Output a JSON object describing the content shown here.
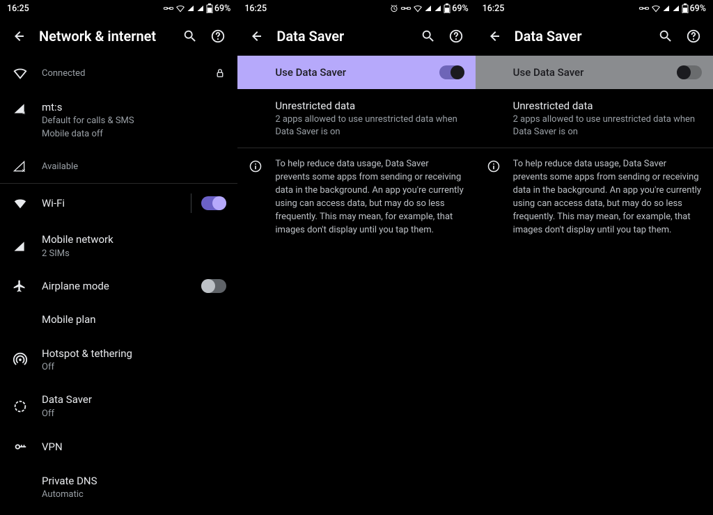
{
  "status": {
    "time": "16:25",
    "battery": "69%"
  },
  "pane1": {
    "title": "Network & internet",
    "wifi_status": "Connected",
    "sim_name": "mt:s",
    "sim_sub1": "Default for calls & SMS",
    "sim_sub2": "Mobile data off",
    "sim2_status": "Available",
    "wifi_label": "Wi-Fi",
    "mobile_net": "Mobile network",
    "mobile_net_sub": "2 SIMs",
    "airplane": "Airplane mode",
    "mobile_plan": "Mobile plan",
    "hotspot": "Hotspot & tethering",
    "hotspot_sub": "Off",
    "datasaver": "Data Saver",
    "datasaver_sub": "Off",
    "vpn": "VPN",
    "dns": "Private DNS",
    "dns_sub": "Automatic"
  },
  "pane2": {
    "title": "Data Saver",
    "banner_label": "Use Data Saver",
    "unrestricted_title": "Unrestricted data",
    "unrestricted_sub": "2 apps allowed to use unrestricted data when Data Saver is on",
    "info_text": "To help reduce data usage, Data Saver prevents some apps from sending or receiving data in the background. An app you're currently using can access data, but may do so less frequently. This may mean, for example, that images don't display until you tap them."
  },
  "pane3": {
    "title": "Data Saver",
    "banner_label": "Use Data Saver",
    "unrestricted_title": "Unrestricted data",
    "unrestricted_sub": "2 apps allowed to use unrestricted data when Data Saver is on",
    "info_text": "To help reduce data usage, Data Saver prevents some apps from sending or receiving data in the background. An app you're currently using can access data, but may do so less frequently. This may mean, for example, that images don't display until you tap them."
  }
}
